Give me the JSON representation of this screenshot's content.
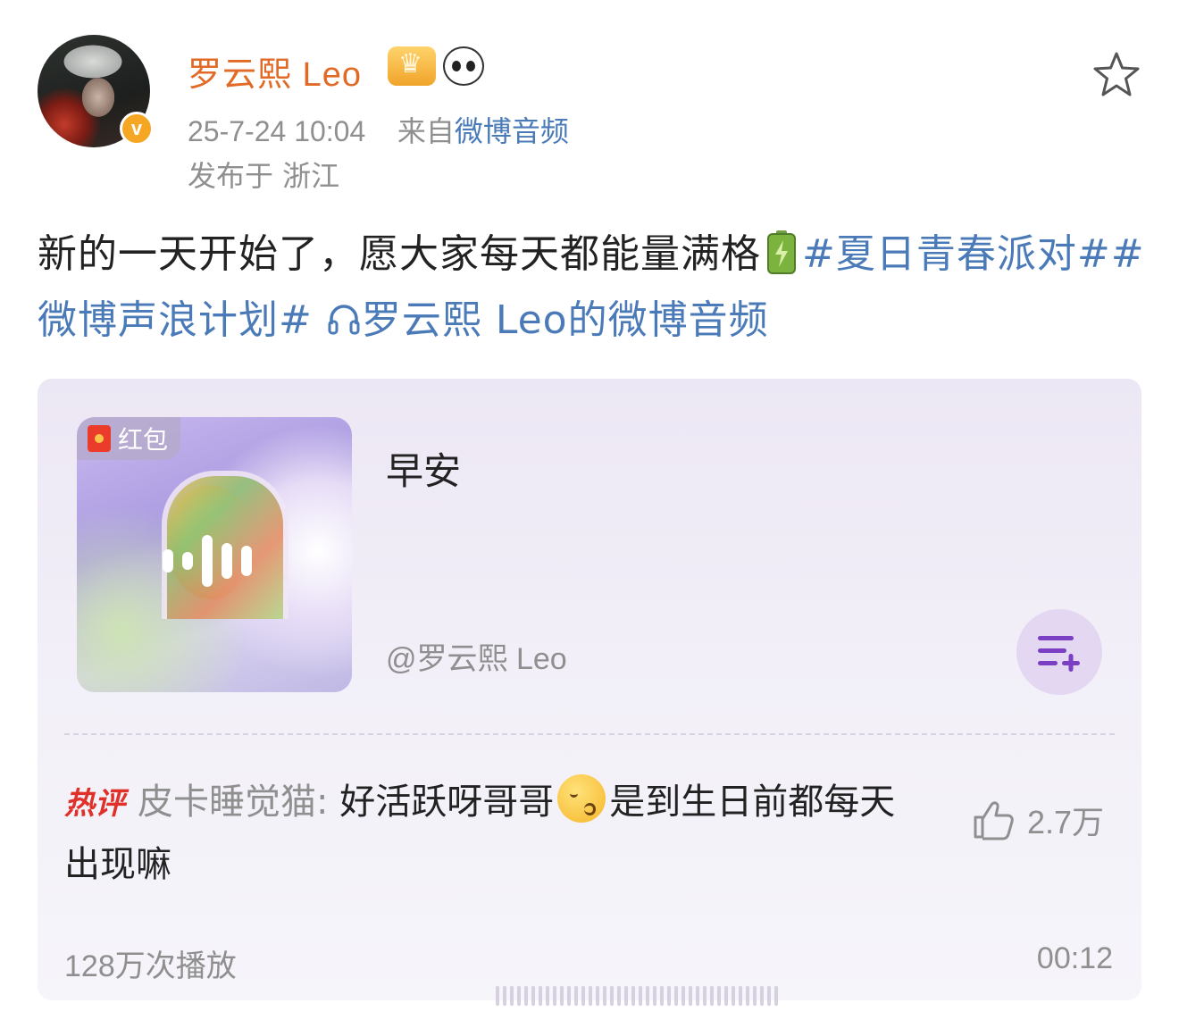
{
  "post": {
    "username": "罗云熙 Leo",
    "timestamp": "25-7-24 10:04",
    "source_prefix": "来自",
    "source_name": "微博音频",
    "location": "发布于 浙江",
    "text_main": "新的一天开始了，愿大家每天都能量满格",
    "topic_1": "#夏日青春派对#",
    "topic_2": "#微博声浪计划#",
    "audio_link": "罗云熙 Leo的微博音频"
  },
  "audio_card": {
    "redpacket_label": "红包",
    "title": "早安",
    "artist": "@罗云熙 Leo",
    "hot_comment": {
      "tag": "热评",
      "commenter": "皮卡睡觉猫:",
      "text_before": " 好活跃呀哥哥",
      "text_after": "是到生日前都每天出现嘛",
      "likes": "2.7万"
    },
    "play_count": "128万次播放",
    "duration": "00:12"
  },
  "colors": {
    "username": "#e06a26",
    "link": "#4a7ab8",
    "muted": "#8f8f8f",
    "hot_tag": "#e0302a"
  },
  "icons": [
    "verified-badge-icon",
    "crown-badge-icon",
    "panda-badge-icon",
    "star-icon",
    "battery-icon",
    "headphone-icon",
    "redpacket-icon",
    "waveform-icon",
    "playlist-add-icon",
    "thumbs-up-icon",
    "kiss-emoji-icon"
  ]
}
